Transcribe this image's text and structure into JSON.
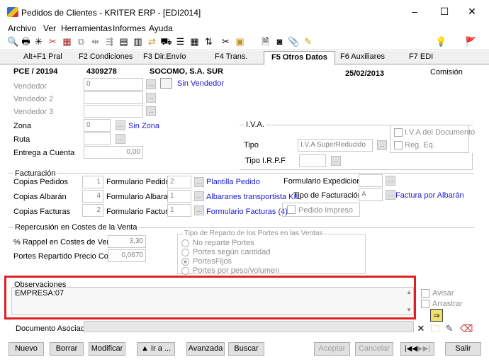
{
  "window": {
    "title": "Pedidos de Clientes - KRITER ERP - [EDI2014]",
    "minimize": "–",
    "maximize": "☐",
    "close": "✕"
  },
  "menu": [
    "Archivo",
    "Ver",
    "Herramientas",
    "Informes",
    "Ayuda"
  ],
  "tabs": [
    "Alt+F1 Pral",
    "F2 Condiciones",
    "F3 Dir.Envío",
    "F4 Trans.",
    "F5 Otros Datos",
    "F6 Auxiliares",
    "F7 EDI"
  ],
  "header": {
    "doc": "PCE / 20194",
    "code": "4309278",
    "customer": "SOCOMO, S.A. SUR",
    "date": "25/02/2013",
    "comision": "Comisión"
  },
  "vendedores": {
    "v1_label": "Vendedor",
    "v1_value": "0",
    "v2_label": "Vendedor 2",
    "v3_label": "Vendedor 3",
    "sin_vendedor": "Sin Vendedor"
  },
  "zona": {
    "label": "Zona",
    "value": "0",
    "sin_zona": "Sin Zona",
    "ruta": "Ruta",
    "entrega": "Entrega a Cuenta",
    "entrega_value": "0,00"
  },
  "iva": {
    "title": "I.V.A.",
    "del_documento": "I.V.A del Documento",
    "tipo_label": "Tipo",
    "tipo_value": "I.V.A SuperReducido",
    "reg_eq": "Reg. Eq.",
    "irpf": "Tipo I.R.P.F"
  },
  "facturacion": {
    "title": "Facturación",
    "copias_pedidos": "Copias Pedidos",
    "copias_pedidos_v": "1",
    "form_pedidos": "Formulario Pedidos",
    "form_pedidos_v": "2",
    "plantilla": "Plantilla Pedido",
    "form_exped": "Formulario Expediciones",
    "copias_albaran": "Copias Albarán",
    "copias_albaran_v": "4",
    "form_albaranes": "Formulario Albaranes",
    "form_albaranes_v": "1",
    "albaranes_link": "Albaranes transportista KIL",
    "tipo_fact": "Tipo de Facturación",
    "tipo_fact_v": "A",
    "fact_albaran": "Factura por Albarán",
    "copias_facturas": "Copias Facturas",
    "copias_facturas_v": "2",
    "form_facturas": "Formulario Facturas",
    "form_facturas_v": "1",
    "form_facturas_link": "Formulario Facturas (4)",
    "pedido_impreso": "Pedido Impreso"
  },
  "repercusion": {
    "title": "Repercusión en Costes de la Venta",
    "rappel": "% Rappel en Costes de Venta",
    "rappel_v": "3,30",
    "portes": "Portes Repartido Precio Coste",
    "portes_v": "0,0670",
    "tipo_title": "Tipo de Reparto de los Portes en las Ventas",
    "opts": [
      "No reparte Portes",
      "Portes según cantidad",
      "PortesFijos",
      "Portes por peso/volumen"
    ]
  },
  "observaciones": {
    "title": "Observaciones",
    "text": "EMPRESA:07",
    "avisar": "Avisar",
    "arrastrar": "Arrastrar"
  },
  "doc_asociado": "Documento Asociado",
  "buttons": {
    "nuevo": "Nuevo",
    "borrar": "Borrar",
    "modificar": "Modificar",
    "ir": "▲ Ir a ...",
    "avanzada": "Avanzada",
    "buscar": "Buscar",
    "aceptar": "Aceptar",
    "cancelar": "Cancelar",
    "salir": "Salir"
  },
  "colors": {
    "accent_red": "#e02020",
    "link_blue": "#1a1ad0"
  }
}
